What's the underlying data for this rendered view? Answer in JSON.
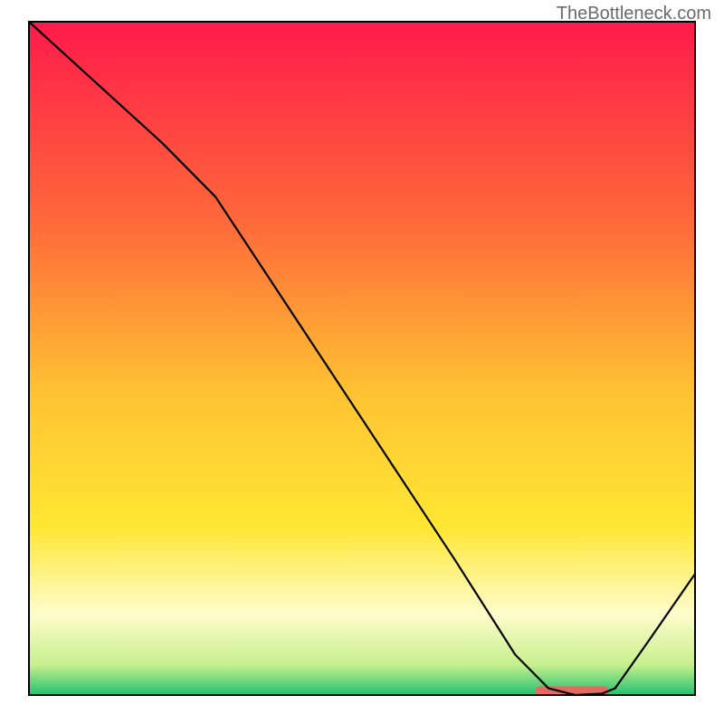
{
  "watermark": {
    "text": "TheBottleneck.com"
  },
  "chart_data": {
    "type": "line",
    "title": "",
    "xlabel": "",
    "ylabel": "",
    "xlim": [
      0,
      100
    ],
    "ylim": [
      0,
      100
    ],
    "grid": false,
    "legend": false,
    "background": {
      "gradient_stops": [
        {
          "offset": 0.0,
          "color": "#ff1a4b"
        },
        {
          "offset": 0.3,
          "color": "#ff6a3a"
        },
        {
          "offset": 0.55,
          "color": "#ffc233"
        },
        {
          "offset": 0.75,
          "color": "#ffe733"
        },
        {
          "offset": 0.88,
          "color": "#fffccc"
        },
        {
          "offset": 0.955,
          "color": "#c7f08e"
        },
        {
          "offset": 1.0,
          "color": "#22c26e"
        }
      ],
      "x": [
        0,
        100
      ],
      "y": [
        0,
        100
      ]
    },
    "series": [
      {
        "name": "bottleneck-curve",
        "color": "#000000",
        "width": 2.2,
        "x": [
          0,
          10,
          20,
          28,
          40,
          52,
          64,
          73,
          78,
          82,
          86,
          88,
          93,
          100
        ],
        "y": [
          100,
          91,
          82,
          74,
          56,
          38,
          20,
          6,
          1,
          0,
          0.2,
          1,
          8,
          18
        ]
      }
    ],
    "marker_band": {
      "name": "optimal-range",
      "color": "#e36a61",
      "x_start": 76,
      "x_end": 87,
      "y": 0.6,
      "thickness": 1.4
    },
    "frame": {
      "left": 4,
      "right": 4,
      "top": 3,
      "bottom": 4,
      "color": "#000000",
      "width": 2
    }
  }
}
